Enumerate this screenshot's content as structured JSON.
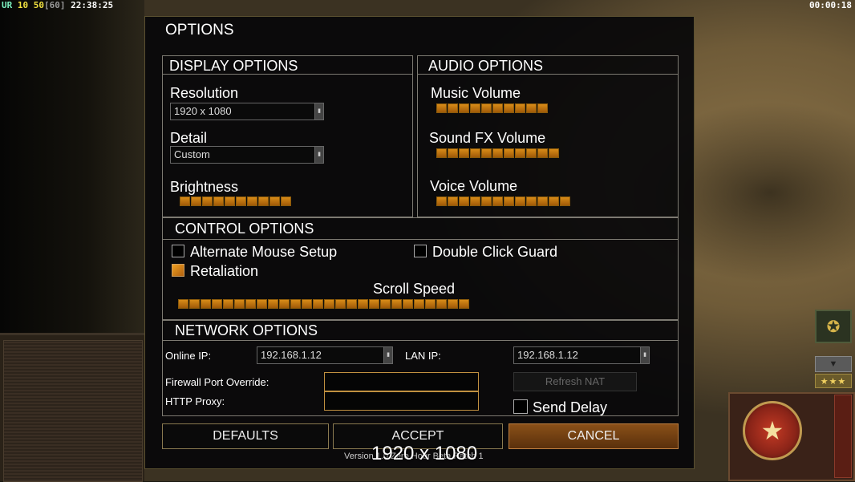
{
  "hud": {
    "left_label": "UR",
    "left_v1": "10",
    "left_v2": "50",
    "left_v3": "[60]",
    "left_time": "22:38:25",
    "right_time": "00:00:18"
  },
  "dialog": {
    "title": "OPTIONS",
    "display": {
      "heading": "DISPLAY OPTIONS",
      "resolution_label": "Resolution",
      "resolution_value": "1920 x 1080",
      "detail_label": "Detail",
      "detail_value": "Custom",
      "brightness_label": "Brightness",
      "brightness_level": 10
    },
    "audio": {
      "heading": "AUDIO OPTIONS",
      "music_label": "Music Volume",
      "music_level": 10,
      "sfx_label": "Sound FX Volume",
      "sfx_level": 11,
      "voice_label": "Voice Volume",
      "voice_level": 12
    },
    "control": {
      "heading": "CONTROL OPTIONS",
      "alt_mouse_label": "Alternate Mouse Setup",
      "alt_mouse_checked": false,
      "double_click_label": "Double Click Guard",
      "double_click_checked": false,
      "retaliation_label": "Retaliation",
      "retaliation_checked": true,
      "scroll_label": "Scroll Speed",
      "scroll_level": 26
    },
    "network": {
      "heading": "NETWORK OPTIONS",
      "online_ip_label": "Online IP:",
      "online_ip_value": "192.168.1.12",
      "lan_ip_label": "LAN IP:",
      "lan_ip_value": "192.168.1.12",
      "firewall_label": "Firewall Port Override:",
      "firewall_value": "",
      "proxy_label": "HTTP Proxy:",
      "proxy_value": "",
      "refresh_nat_label": "Refresh NAT",
      "send_delay_label": "Send Delay",
      "send_delay_checked": false
    },
    "buttons": {
      "defaults": "DEFAULTS",
      "accept": "ACCEPT",
      "cancel": "CANCEL"
    },
    "version": "Version 1.0 Zero Hour Beta Patch 1",
    "overlay_resolution": "1920 x 1080"
  },
  "colors": {
    "slider_orange": "#d88c18",
    "cancel_brown": "#8a5018",
    "border_gold": "#c09040"
  },
  "icons": {
    "rank": "rank-eagle-icon",
    "scroll_down": "chevron-down-icon",
    "stars": "three-stars-icon",
    "faction": "faction-star-emblem-icon"
  }
}
